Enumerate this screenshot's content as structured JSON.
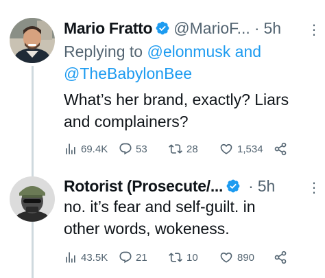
{
  "tweets": [
    {
      "name": "Mario Fratto",
      "handle": "@MarioF...",
      "dot": "·",
      "time": "5h",
      "more": "⋮",
      "reply_prefix": "Replying to",
      "mention1": "@elonmusk",
      "reply_and": "and",
      "mention2": "@TheBabylonBee",
      "text_line1": "What’s her brand, exactly? Liars",
      "text_line2": "and complainers?",
      "views": "69.4K",
      "replies": "53",
      "retweets": "28",
      "likes": "1,534"
    },
    {
      "name": "Rotorist (Prosecute/...",
      "dot": "·",
      "time": "5h",
      "more": "⋮",
      "text_line1": "no. it’s fear and self-guilt. in",
      "text_line2": "other words, wokeness.",
      "views": "43.5K",
      "replies": "21",
      "retweets": "10",
      "likes": "890"
    }
  ],
  "colors": {
    "accent": "#1d9bf0",
    "muted": "#536471",
    "text": "#0f1419",
    "thread_line": "#cfd9de"
  },
  "icons": [
    "verified-badge-icon",
    "more-icon",
    "views-icon",
    "reply-icon",
    "retweet-icon",
    "like-icon",
    "share-icon"
  ]
}
